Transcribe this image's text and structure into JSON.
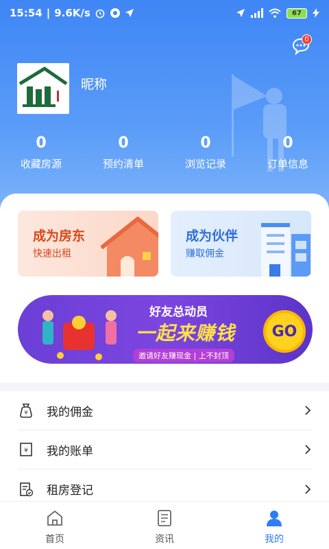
{
  "status_bar": {
    "time": "15:54",
    "speed": "9.6K/s",
    "battery": "67"
  },
  "header": {
    "nickname": "昵称",
    "message_badge": "0"
  },
  "stats": [
    {
      "value": "0",
      "label": "收藏房源"
    },
    {
      "value": "0",
      "label": "预约清单"
    },
    {
      "value": "0",
      "label": "浏览记录"
    },
    {
      "value": "0",
      "label": "订单信息"
    }
  ],
  "promos": {
    "landlord": {
      "title": "成为房东",
      "subtitle": "快速出租"
    },
    "partner": {
      "title": "成为伙伴",
      "subtitle": "赚取佣金"
    }
  },
  "banner": {
    "title": "好友总动员",
    "main": "一起来赚钱",
    "subtitle": "邀请好友赚现金 | 上不封顶",
    "button": "GO"
  },
  "menu": [
    {
      "label": "我的佣金",
      "icon": "money-bag-icon"
    },
    {
      "label": "我的账单",
      "icon": "bill-icon"
    },
    {
      "label": "租房登记",
      "icon": "register-icon"
    }
  ],
  "tabs": [
    {
      "label": "首页",
      "icon": "home-icon"
    },
    {
      "label": "资讯",
      "icon": "news-icon"
    },
    {
      "label": "我的",
      "icon": "user-icon"
    }
  ],
  "colors": {
    "primary": "#3f86f5",
    "active_tab": "#2f7cf6",
    "badge": "#ff3b30"
  }
}
